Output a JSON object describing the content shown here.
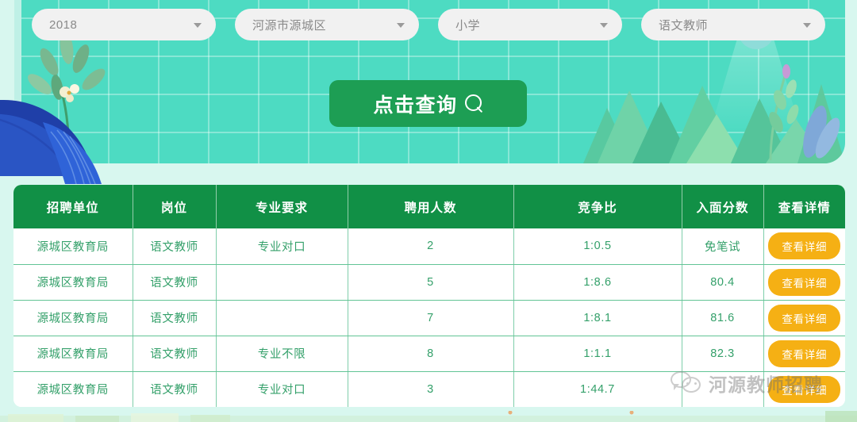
{
  "filters": [
    {
      "name": "year",
      "value": "2018",
      "icon": "chevron-down-icon"
    },
    {
      "name": "region",
      "value": "河源市源城区",
      "icon": "chevron-down-icon"
    },
    {
      "name": "level",
      "value": "小学",
      "icon": "chevron-down-icon"
    },
    {
      "name": "position",
      "value": "语文教师",
      "icon": "chevron-down-icon"
    }
  ],
  "search_button": {
    "label": "点击查询",
    "icon": "search-icon"
  },
  "table": {
    "headers": [
      "招聘单位",
      "岗位",
      "专业要求",
      "聘用人数",
      "竞争比",
      "入面分数",
      "查看详情"
    ],
    "rows": [
      {
        "unit": "源城区教育局",
        "post": "语文教师",
        "major": "专业对口",
        "hires": "2",
        "ratio": "1:0.5",
        "score": "免笔试",
        "action": "查看详细"
      },
      {
        "unit": "源城区教育局",
        "post": "语文教师",
        "major": "",
        "hires": "5",
        "ratio": "1:8.6",
        "score": "80.4",
        "action": "查看详细"
      },
      {
        "unit": "源城区教育局",
        "post": "语文教师",
        "major": "",
        "hires": "7",
        "ratio": "1:8.1",
        "score": "81.6",
        "action": "查看详细"
      },
      {
        "unit": "源城区教育局",
        "post": "语文教师",
        "major": "专业不限",
        "hires": "8",
        "ratio": "1:1.1",
        "score": "82.3",
        "action": "查看详细"
      },
      {
        "unit": "源城区教育局",
        "post": "语文教师",
        "major": "专业对口",
        "hires": "3",
        "ratio": "1:44.7",
        "score": "",
        "action": "查看详细"
      }
    ]
  },
  "watermark": {
    "text": "河源教师招聘",
    "icon": "wechat-icon"
  },
  "colors": {
    "banner": "#4ddbc2",
    "page_background": "#d8f7ef",
    "table_header_green": "#119046",
    "search_button_green": "#1d9e54",
    "detail_button_orange": "#f5b014",
    "table_text_green": "#34a06a",
    "lamp_blue": "#4d86f0"
  }
}
